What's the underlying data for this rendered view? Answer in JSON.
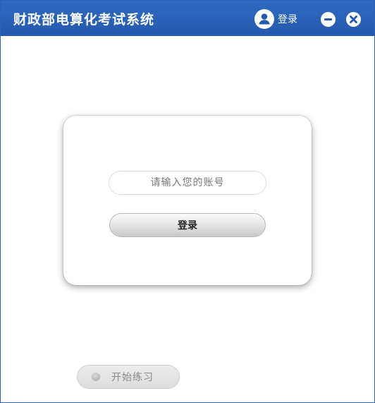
{
  "window": {
    "title": "财政部电算化考试系统"
  },
  "header": {
    "login_label": "登录",
    "icons": {
      "user": "user-circle-icon",
      "minimize": "minimize-icon",
      "close": "close-icon"
    }
  },
  "login_form": {
    "account_placeholder": "请输入您的账号",
    "account_value": "",
    "submit_label": "登录"
  },
  "practice": {
    "label": "开始练习"
  },
  "colors": {
    "titlebar": "#2b62b4",
    "card_background": "#ffffff",
    "practice_text": "#8a8a8a"
  }
}
